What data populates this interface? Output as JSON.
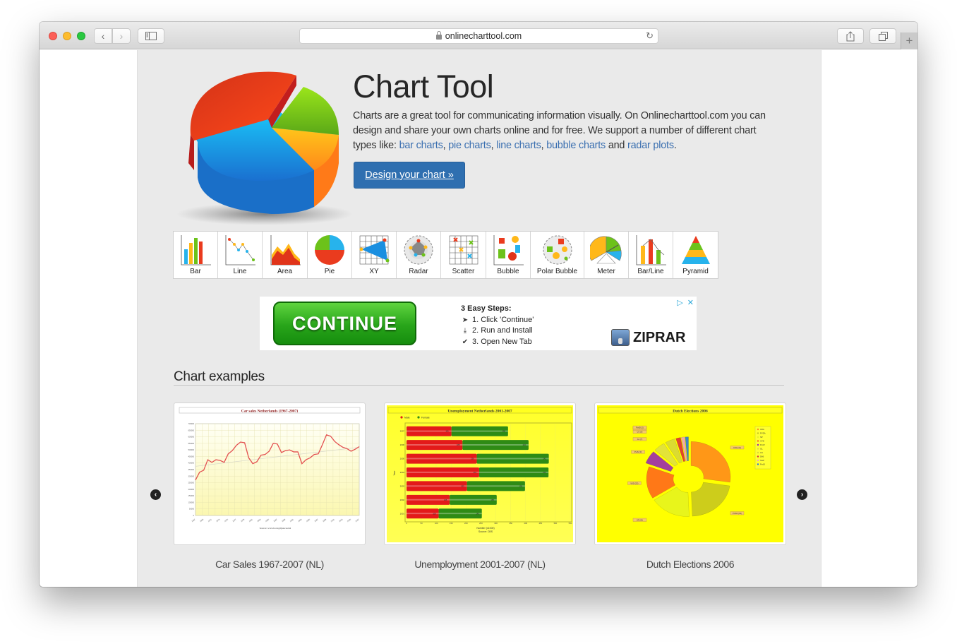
{
  "browser": {
    "url": "onlinecharttool.com",
    "back_icon": "chevron-left-icon",
    "forward_icon": "chevron-right-icon",
    "sidebar_icon": "sidebar-icon",
    "reload_icon": "reload-icon",
    "share_icon": "share-icon",
    "tabs_icon": "tabs-icon",
    "new_tab_label": "+"
  },
  "hero": {
    "title": "Chart Tool",
    "text_before": "Charts are a great tool for communicating information visually. On Onlinecharttool.com you can design and share your own charts online and for free. We support a number of different chart types like: ",
    "links": [
      "bar charts",
      "pie charts",
      "line charts",
      "bubble charts",
      "radar plots"
    ],
    "sep_comma": ", ",
    "sep_and": " and ",
    "text_after": ".",
    "cta_label": "Design your chart »",
    "link_color": "#3a6fb0",
    "cta_color": "#2f6fb0"
  },
  "chart_types": [
    {
      "label": "Bar",
      "icon": "bar-chart-icon"
    },
    {
      "label": "Line",
      "icon": "line-chart-icon"
    },
    {
      "label": "Area",
      "icon": "area-chart-icon"
    },
    {
      "label": "Pie",
      "icon": "pie-chart-icon"
    },
    {
      "label": "XY",
      "icon": "xy-chart-icon"
    },
    {
      "label": "Radar",
      "icon": "radar-chart-icon"
    },
    {
      "label": "Scatter",
      "icon": "scatter-chart-icon"
    },
    {
      "label": "Bubble",
      "icon": "bubble-chart-icon"
    },
    {
      "label": "Polar Bubble",
      "icon": "polar-bubble-chart-icon"
    },
    {
      "label": "Meter",
      "icon": "meter-chart-icon"
    },
    {
      "label": "Bar/Line",
      "icon": "bar-line-chart-icon"
    },
    {
      "label": "Pyramid",
      "icon": "pyramid-chart-icon"
    }
  ],
  "ad": {
    "button_label": "CONTINUE",
    "steps_title": "3 Easy Steps:",
    "steps": [
      {
        "icon": "cursor-icon",
        "text": "1. Click 'Continue'"
      },
      {
        "icon": "download-icon",
        "text": "2. Run and Install"
      },
      {
        "icon": "check-circle-icon",
        "text": "3. Open New Tab"
      }
    ],
    "brand": "ZIPRAR",
    "adchoices_label": "▷",
    "close_label": "✕"
  },
  "examples": {
    "title": "Chart examples",
    "prev_label": "‹",
    "next_label": "›",
    "items": [
      {
        "caption": "Car Sales 1967-2007 (NL)",
        "chart_title": "Car sales Netherlands (1967-2007)",
        "source": "Source: www.bovagrijkswaal.nl"
      },
      {
        "caption": "Unemployment 2001-2007 (NL)",
        "chart_title": "Unemployment Netherlands 2001-2007",
        "legend": [
          "Male",
          "Female"
        ],
        "xlabel": "Number (x1000)",
        "ylabel": "Year",
        "source": "Source: CBS"
      },
      {
        "caption": "Dutch Elections 2006",
        "chart_title": "Dutch Elections 2006",
        "legend": [
          "CDA",
          "PVDA",
          "SP",
          "VVD",
          "PvdV",
          "GL",
          "CU",
          "D66",
          "SGP",
          "PvdD"
        ]
      }
    ]
  },
  "chart_data": [
    {
      "type": "line",
      "title": "Car sales Netherlands (1967-2007)",
      "xlabel": "",
      "ylabel": "",
      "x": [
        1967,
        1968,
        1969,
        1970,
        1971,
        1972,
        1973,
        1974,
        1975,
        1976,
        1977,
        1978,
        1979,
        1980,
        1981,
        1982,
        1983,
        1984,
        1985,
        1986,
        1987,
        1988,
        1989,
        1990,
        1991,
        1992,
        1993,
        1994,
        1995,
        1996,
        1997,
        1998,
        1999,
        2000,
        2001,
        2002,
        2003,
        2004,
        2005,
        2006,
        2007
      ],
      "series": [
        {
          "name": "Car sales",
          "values": [
            270,
            330,
            345,
            425,
            405,
            425,
            420,
            405,
            470,
            495,
            535,
            560,
            555,
            440,
            395,
            410,
            460,
            465,
            490,
            550,
            545,
            480,
            495,
            500,
            485,
            485,
            395,
            425,
            440,
            465,
            470,
            540,
            615,
            605,
            565,
            540,
            520,
            510,
            490,
            505,
            525
          ]
        }
      ],
      "trendline": true,
      "ylim": [
        0,
        700
      ],
      "source": "Source: www.bovagrijkswaal.nl"
    },
    {
      "type": "bar",
      "orientation": "horizontal",
      "stacked": true,
      "title": "Unemployment Netherlands 2001-2007",
      "xlabel": "Number (x1000)",
      "ylabel": "Year",
      "categories": [
        "2007",
        "2006",
        "2005",
        "2004",
        "2003",
        "2002",
        "2001"
      ],
      "series": [
        {
          "name": "Male",
          "color": "#e31a1a",
          "values": [
            151,
            188,
            236,
            244,
            203,
            145,
            108
          ]
        },
        {
          "name": "Female",
          "color": "#2e8b15",
          "values": [
            190,
            222,
            242,
            233,
            195,
            158,
            145
          ]
        }
      ],
      "xlim": [
        0,
        550
      ],
      "xticks": [
        0,
        50,
        100,
        150,
        200,
        250,
        300,
        350,
        400,
        450,
        500,
        550
      ],
      "source": "Source: CBS"
    },
    {
      "type": "pie",
      "title": "Dutch Elections 2006",
      "categories": [
        "CDA",
        "PVDA",
        "SP",
        "VVD",
        "PvdV",
        "GL",
        "CU",
        "D66",
        "SGP",
        "PvdD"
      ],
      "values": [
        41,
        33,
        25,
        22,
        9,
        7,
        6,
        3,
        2,
        2
      ],
      "labels": [
        "CDA (41)",
        "PVDA (33)",
        "SP (25)",
        "VVD (22)",
        "PvdV (9)",
        "GL (7)",
        "CU (6)",
        "D66 (3)",
        "SGP (2)",
        "PvdD (2)"
      ],
      "colors": [
        "#ff8c1a",
        "#c8c81e",
        "#e6f51e",
        "#ff6a1a",
        "#9b2bb0",
        "#e0e040",
        "#d8d838",
        "#e03030",
        "#f2a0c0",
        "#2a7ad8"
      ],
      "legend": "right"
    }
  ]
}
